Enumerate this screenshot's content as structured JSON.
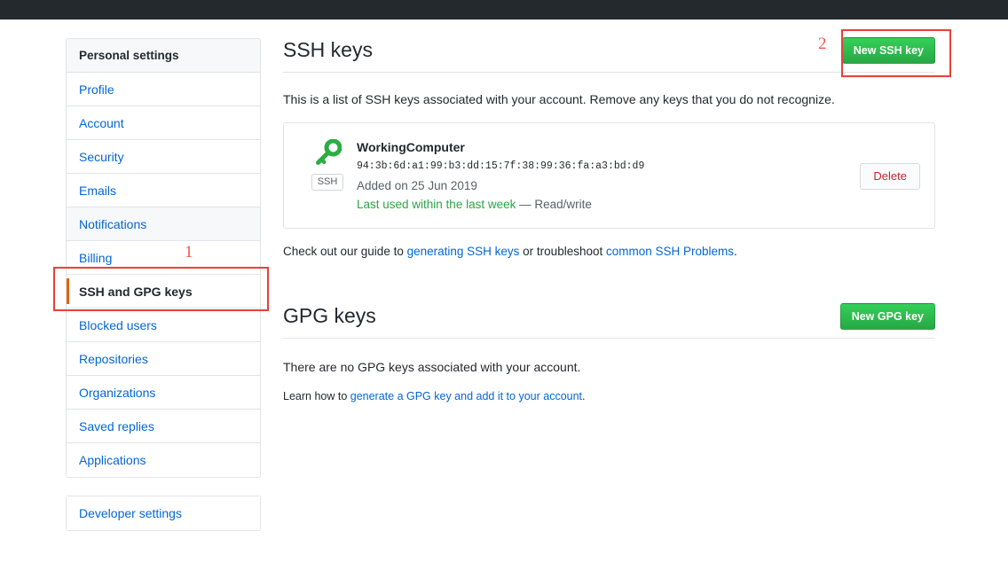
{
  "sidebar": {
    "header": {
      "label": "Personal settings"
    },
    "items": [
      {
        "label": "Profile",
        "selected": false,
        "tinted": false
      },
      {
        "label": "Account",
        "selected": false,
        "tinted": false
      },
      {
        "label": "Security",
        "selected": false,
        "tinted": false
      },
      {
        "label": "Emails",
        "selected": false,
        "tinted": false
      },
      {
        "label": "Notifications",
        "selected": false,
        "tinted": true
      },
      {
        "label": "Billing",
        "selected": false,
        "tinted": false
      },
      {
        "label": "SSH and GPG keys",
        "selected": true,
        "tinted": false
      },
      {
        "label": "Blocked users",
        "selected": false,
        "tinted": false
      },
      {
        "label": "Repositories",
        "selected": false,
        "tinted": false
      },
      {
        "label": "Organizations",
        "selected": false,
        "tinted": false
      },
      {
        "label": "Saved replies",
        "selected": false,
        "tinted": false
      },
      {
        "label": "Applications",
        "selected": false,
        "tinted": false
      }
    ],
    "developer_settings": {
      "label": "Developer settings"
    }
  },
  "ssh_section": {
    "title": "SSH keys",
    "new_key_button": "New SSH key",
    "description": "This is a list of SSH keys associated with your account. Remove any keys that you do not recognize.",
    "key": {
      "icon": "key-icon",
      "badge": "SSH",
      "title": "WorkingComputer",
      "fingerprint": "94:3b:6d:a1:99:b3:dd:15:7f:38:99:36:fa:a3:bd:d9",
      "added": "Added on 25 Jun 2019",
      "last_used": "Last used within the last week",
      "access": " — Read/write",
      "delete_button": "Delete"
    },
    "guide": {
      "prefix": "Check out our guide to ",
      "link1": "generating SSH keys",
      "middle": " or troubleshoot ",
      "link2": "common SSH Problems",
      "suffix": "."
    }
  },
  "gpg_section": {
    "title": "GPG keys",
    "new_key_button": "New GPG key",
    "empty_message": "There are no GPG keys associated with your account.",
    "learn": {
      "prefix": "Learn how to ",
      "link": "generate a GPG key and add it to your account",
      "suffix": "."
    }
  },
  "annotations": [
    {
      "number": "1",
      "target": "sidebar-item-ssh-and-gpg-keys"
    },
    {
      "number": "2",
      "target": "new-ssh-key-button"
    }
  ],
  "colors": {
    "topbar": "#24292e",
    "link": "#0366d6",
    "green_button": "#28a745",
    "selected_accent": "#e36209",
    "delete_text": "#cb2431",
    "annotation": "#e8403a",
    "success_text": "#28a745"
  }
}
